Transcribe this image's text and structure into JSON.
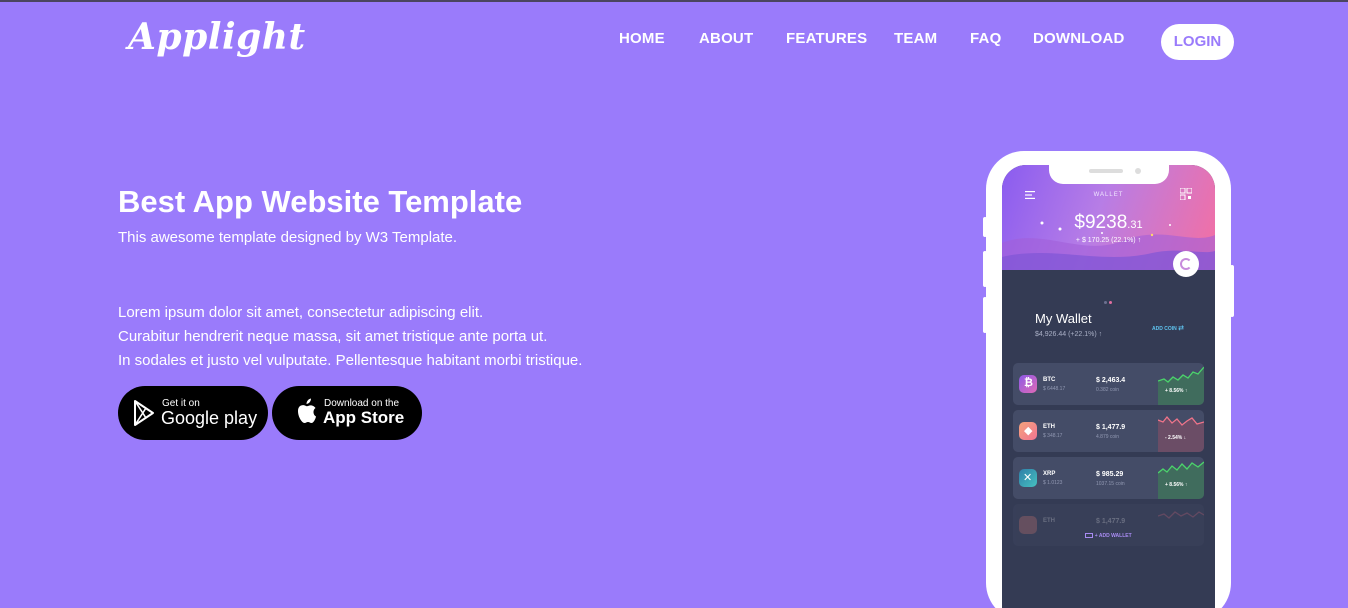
{
  "brand": {
    "logo": "Applight"
  },
  "nav": {
    "items": [
      "HOME",
      "ABOUT",
      "FEATURES",
      "TEAM",
      "FAQ",
      "DOWNLOAD"
    ],
    "login": "LOGIN"
  },
  "hero": {
    "title": "Best App Website Template",
    "subtitle": "This awesome template designed by W3 Template.",
    "body": [
      "Lorem ipsum dolor sit amet, consectetur adipiscing elit.",
      "Curabitur hendrerit neque massa, sit amet tristique ante porta ut.",
      "In sodales et justo vel vulputate. Pellentesque habitant morbi tristique."
    ],
    "google_play": {
      "small": "Get it on",
      "big": "Google play"
    },
    "app_store": {
      "small": "Download on the",
      "big": "App Store"
    }
  },
  "phone": {
    "header_label": "WALLET",
    "balance_main": "$9238",
    "balance_cents": ".31",
    "balance_change": "+ $ 170.25 (22.1%) ↑",
    "wallet_title": "My Wallet",
    "wallet_sub": "$4,926.44 (+22.1%) ↑",
    "add_coin": "ADD COIN",
    "coins": [
      {
        "symbol": "BTC",
        "sub": "$ 6448.17",
        "value": "$ 2,463.4",
        "amount": "0.382 coin",
        "pct": "+ 8.56% ↑",
        "trend": "up"
      },
      {
        "symbol": "ETH",
        "sub": "$ 348.17",
        "value": "$ 1,477.9",
        "amount": "4.879 coin",
        "pct": "- 2.54% ↓",
        "trend": "down"
      },
      {
        "symbol": "XRP",
        "sub": "$ 1.0123",
        "value": "$ 985.29",
        "amount": "1037.15 coin",
        "pct": "+ 8.56% ↑",
        "trend": "up"
      },
      {
        "symbol": "ETH",
        "sub": "",
        "value": "$ 1,477.9",
        "amount": "",
        "pct": "",
        "trend": "down"
      }
    ],
    "add_wallet": "+ ADD WALLET"
  },
  "colors": {
    "background": "#9a7bfb",
    "accent": "#9a7bfb",
    "btc": "#b15ad6",
    "eth": "#f58a83",
    "xrp": "#3aa3b8",
    "up": "#4bd46b",
    "down": "#f0748a"
  }
}
